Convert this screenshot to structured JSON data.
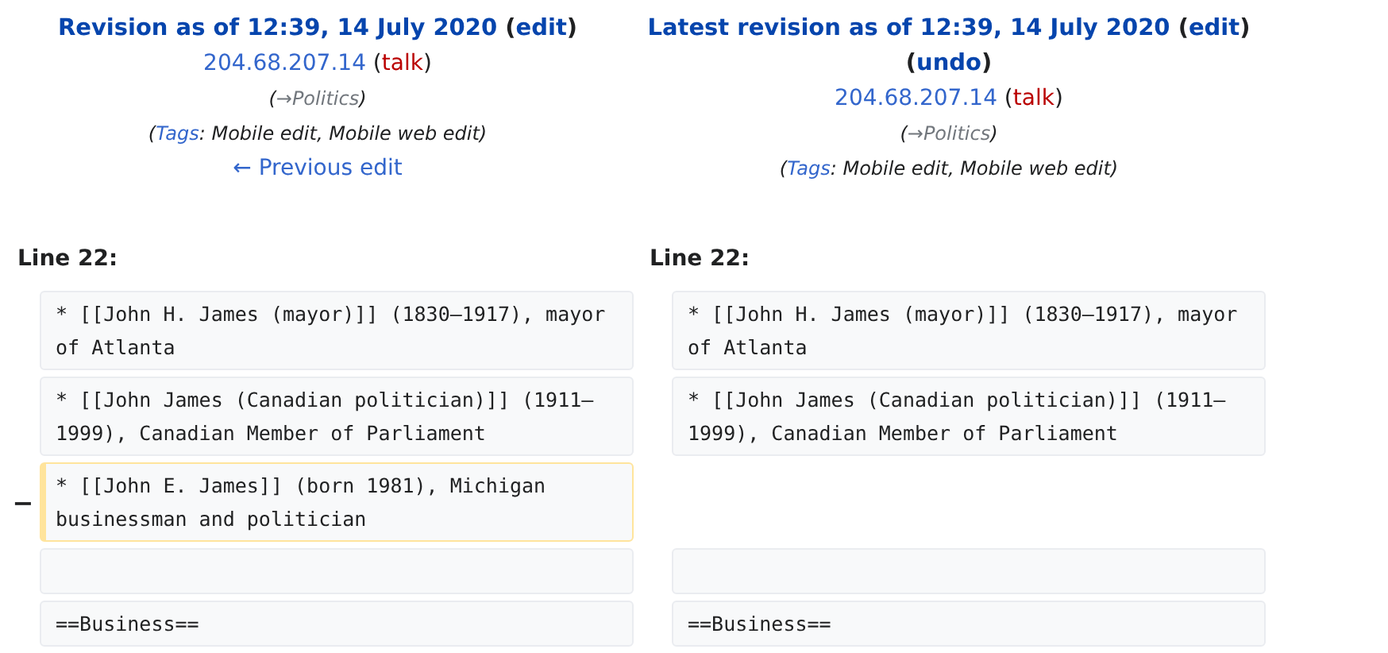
{
  "headers": [
    {
      "lines": [
        {
          "kind": "title",
          "segments": [
            {
              "kind": "link",
              "text": "Revision as of 12:39, 14 July 2020"
            },
            {
              "kind": "plain",
              "text": " ("
            },
            {
              "kind": "link",
              "text": "edit"
            },
            {
              "kind": "plain",
              "text": ")"
            }
          ]
        },
        {
          "kind": "user",
          "segments": [
            {
              "kind": "link",
              "text": "204.68.207.14"
            },
            {
              "kind": "plain",
              "text": " ("
            },
            {
              "kind": "redlink",
              "text": "talk"
            },
            {
              "kind": "plain",
              "text": ")"
            }
          ]
        },
        {
          "kind": "summary",
          "segments": [
            {
              "kind": "plain",
              "text": "("
            },
            {
              "kind": "muted",
              "text": "→Politics"
            },
            {
              "kind": "plain",
              "text": ")"
            }
          ]
        },
        {
          "kind": "tags",
          "segments": [
            {
              "kind": "plain",
              "text": "("
            },
            {
              "kind": "link",
              "text": "Tags"
            },
            {
              "kind": "plain",
              "text": ": Mobile edit, Mobile web edit)"
            }
          ]
        },
        {
          "kind": "nav",
          "segments": [
            {
              "kind": "link",
              "text": "← Previous edit"
            }
          ]
        }
      ]
    },
    {
      "lines": [
        {
          "kind": "title",
          "segments": [
            {
              "kind": "link",
              "text": "Latest revision as of 12:39, 14 July 2020"
            },
            {
              "kind": "plain",
              "text": " ("
            },
            {
              "kind": "link",
              "text": "edit"
            },
            {
              "kind": "plain",
              "text": ")"
            }
          ]
        },
        {
          "kind": "title",
          "segments": [
            {
              "kind": "plain",
              "text": "("
            },
            {
              "kind": "link",
              "text": "undo"
            },
            {
              "kind": "plain",
              "text": ")"
            }
          ]
        },
        {
          "kind": "user",
          "segments": [
            {
              "kind": "link",
              "text": "204.68.207.14"
            },
            {
              "kind": "plain",
              "text": " ("
            },
            {
              "kind": "redlink",
              "text": "talk"
            },
            {
              "kind": "plain",
              "text": ")"
            }
          ]
        },
        {
          "kind": "summary",
          "segments": [
            {
              "kind": "plain",
              "text": "("
            },
            {
              "kind": "muted",
              "text": "→Politics"
            },
            {
              "kind": "plain",
              "text": ")"
            }
          ]
        },
        {
          "kind": "tags",
          "segments": [
            {
              "kind": "plain",
              "text": "("
            },
            {
              "kind": "link",
              "text": "Tags"
            },
            {
              "kind": "plain",
              "text": ": Mobile edit, Mobile web edit)"
            }
          ]
        }
      ]
    }
  ],
  "line_numbers": [
    "Line 22:",
    "Line 22:"
  ],
  "rows": [
    {
      "kind": "context",
      "left": "* [[John H. James (mayor)]] (1830–1917), mayor of Atlanta",
      "right": "* [[John H. James (mayor)]] (1830–1917), mayor of Atlanta"
    },
    {
      "kind": "context",
      "left": "* [[John James (Canadian politician)]] (1911–1999), Canadian Member of Parliament",
      "right": "* [[John James (Canadian politician)]] (1911–1999), Canadian Member of Parliament"
    },
    {
      "kind": "deleted",
      "marker": "−",
      "left": "* [[John E. James]] (born 1981), Michigan businessman and politician"
    },
    {
      "kind": "context"
    },
    {
      "kind": "context",
      "left": "==Business==",
      "right": "==Business=="
    }
  ]
}
